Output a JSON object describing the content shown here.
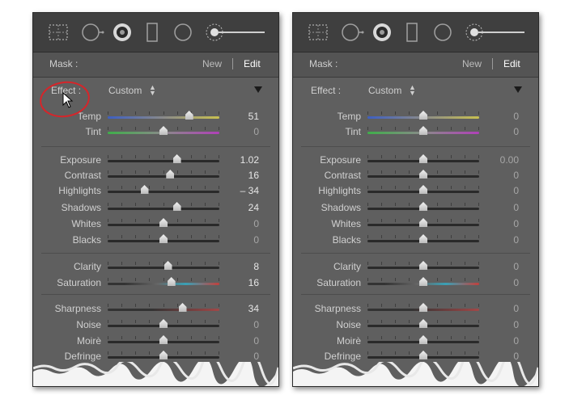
{
  "panels": [
    {
      "mask": {
        "label": "Mask :",
        "new": "New",
        "edit": "Edit"
      },
      "effect": {
        "label": "Effect :",
        "value": "Custom"
      },
      "sliders": [
        {
          "label": "Temp",
          "value": "51",
          "pos": 0.73,
          "track": "temp"
        },
        {
          "label": "Tint",
          "value": "0",
          "pos": 0.5,
          "track": "tint"
        },
        {
          "label": "Exposure",
          "value": "1.02",
          "pos": 0.62,
          "track": "plain"
        },
        {
          "label": "Contrast",
          "value": "16",
          "pos": 0.56,
          "track": "plain"
        },
        {
          "label": "Highlights",
          "value": "– 34",
          "pos": 0.33,
          "track": "plain"
        },
        {
          "label": "Shadows",
          "value": "24",
          "pos": 0.62,
          "track": "plain"
        },
        {
          "label": "Whites",
          "value": "0",
          "pos": 0.5,
          "track": "plain"
        },
        {
          "label": "Blacks",
          "value": "0",
          "pos": 0.5,
          "track": "plain"
        },
        {
          "label": "Clarity",
          "value": "8",
          "pos": 0.54,
          "track": "plain"
        },
        {
          "label": "Saturation",
          "value": "16",
          "pos": 0.57,
          "track": "sat"
        },
        {
          "label": "Sharpness",
          "value": "34",
          "pos": 0.67,
          "track": "sharp"
        },
        {
          "label": "Noise",
          "value": "0",
          "pos": 0.5,
          "track": "plain"
        },
        {
          "label": "Moirè",
          "value": "0",
          "pos": 0.5,
          "track": "plain"
        },
        {
          "label": "Defringe",
          "value": "0",
          "pos": 0.5,
          "track": "plain"
        }
      ]
    },
    {
      "mask": {
        "label": "Mask :",
        "new": "New",
        "edit": "Edit"
      },
      "effect": {
        "label": "Effect :",
        "value": "Custom"
      },
      "sliders": [
        {
          "label": "Temp",
          "value": "0",
          "pos": 0.5,
          "track": "temp"
        },
        {
          "label": "Tint",
          "value": "0",
          "pos": 0.5,
          "track": "tint"
        },
        {
          "label": "Exposure",
          "value": "0.00",
          "pos": 0.5,
          "track": "plain"
        },
        {
          "label": "Contrast",
          "value": "0",
          "pos": 0.5,
          "track": "plain"
        },
        {
          "label": "Highlights",
          "value": "0",
          "pos": 0.5,
          "track": "plain"
        },
        {
          "label": "Shadows",
          "value": "0",
          "pos": 0.5,
          "track": "plain"
        },
        {
          "label": "Whites",
          "value": "0",
          "pos": 0.5,
          "track": "plain"
        },
        {
          "label": "Blacks",
          "value": "0",
          "pos": 0.5,
          "track": "plain"
        },
        {
          "label": "Clarity",
          "value": "0",
          "pos": 0.5,
          "track": "plain"
        },
        {
          "label": "Saturation",
          "value": "0",
          "pos": 0.5,
          "track": "sat"
        },
        {
          "label": "Sharpness",
          "value": "0",
          "pos": 0.5,
          "track": "sharp"
        },
        {
          "label": "Noise",
          "value": "0",
          "pos": 0.5,
          "track": "plain"
        },
        {
          "label": "Moirè",
          "value": "0",
          "pos": 0.5,
          "track": "plain"
        },
        {
          "label": "Defringe",
          "value": "0",
          "pos": 0.5,
          "track": "plain"
        }
      ]
    }
  ],
  "tools": [
    "crop-overlay-icon",
    "spot-removal-icon",
    "red-eye-icon",
    "graduated-filter-icon",
    "radial-filter-icon",
    "adjustment-brush-icon"
  ],
  "colors": {
    "panel_bg": "#5f5f5f",
    "toolbar_bg": "#3f3f3f",
    "annotation": "#d6252a"
  }
}
